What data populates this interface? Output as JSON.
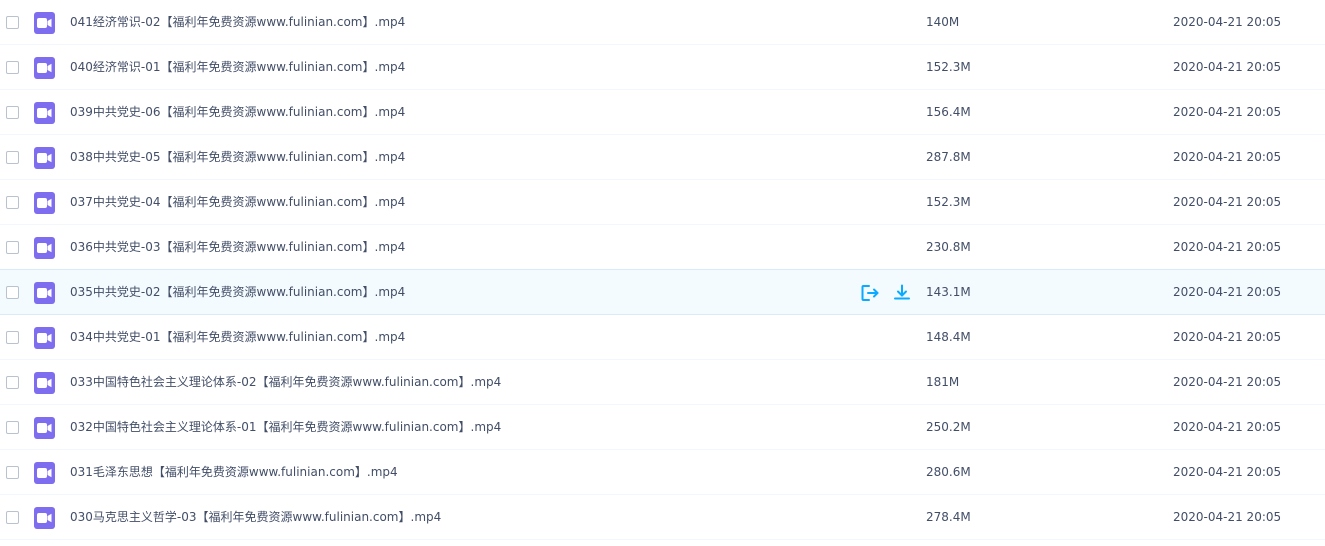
{
  "files": [
    {
      "name": "041经济常识-02【福利年免费资源www.fulinian.com】.mp4",
      "size": "140M",
      "date": "2020-04-21 20:05"
    },
    {
      "name": "040经济常识-01【福利年免费资源www.fulinian.com】.mp4",
      "size": "152.3M",
      "date": "2020-04-21 20:05"
    },
    {
      "name": "039中共党史-06【福利年免费资源www.fulinian.com】.mp4",
      "size": "156.4M",
      "date": "2020-04-21 20:05"
    },
    {
      "name": "038中共党史-05【福利年免费资源www.fulinian.com】.mp4",
      "size": "287.8M",
      "date": "2020-04-21 20:05"
    },
    {
      "name": "037中共党史-04【福利年免费资源www.fulinian.com】.mp4",
      "size": "152.3M",
      "date": "2020-04-21 20:05"
    },
    {
      "name": "036中共党史-03【福利年免费资源www.fulinian.com】.mp4",
      "size": "230.8M",
      "date": "2020-04-21 20:05"
    },
    {
      "name": "035中共党史-02【福利年免费资源www.fulinian.com】.mp4",
      "size": "143.1M",
      "date": "2020-04-21 20:05"
    },
    {
      "name": "034中共党史-01【福利年免费资源www.fulinian.com】.mp4",
      "size": "148.4M",
      "date": "2020-04-21 20:05"
    },
    {
      "name": "033中国特色社会主义理论体系-02【福利年免费资源www.fulinian.com】.mp4",
      "size": "181M",
      "date": "2020-04-21 20:05"
    },
    {
      "name": "032中国特色社会主义理论体系-01【福利年免费资源www.fulinian.com】.mp4",
      "size": "250.2M",
      "date": "2020-04-21 20:05"
    },
    {
      "name": "031毛泽东思想【福利年免费资源www.fulinian.com】.mp4",
      "size": "280.6M",
      "date": "2020-04-21 20:05"
    },
    {
      "name": "030马克思主义哲学-03【福利年免费资源www.fulinian.com】.mp4",
      "size": "278.4M",
      "date": "2020-04-21 20:05"
    }
  ],
  "file_icon": "video-file-icon",
  "hover_actions": {
    "share_icon": "share-icon",
    "download_icon": "download-icon"
  },
  "colors": {
    "video_icon": "#7f6df0",
    "action_blue": "#09aaff",
    "hover_bg": "#f4fbff"
  }
}
